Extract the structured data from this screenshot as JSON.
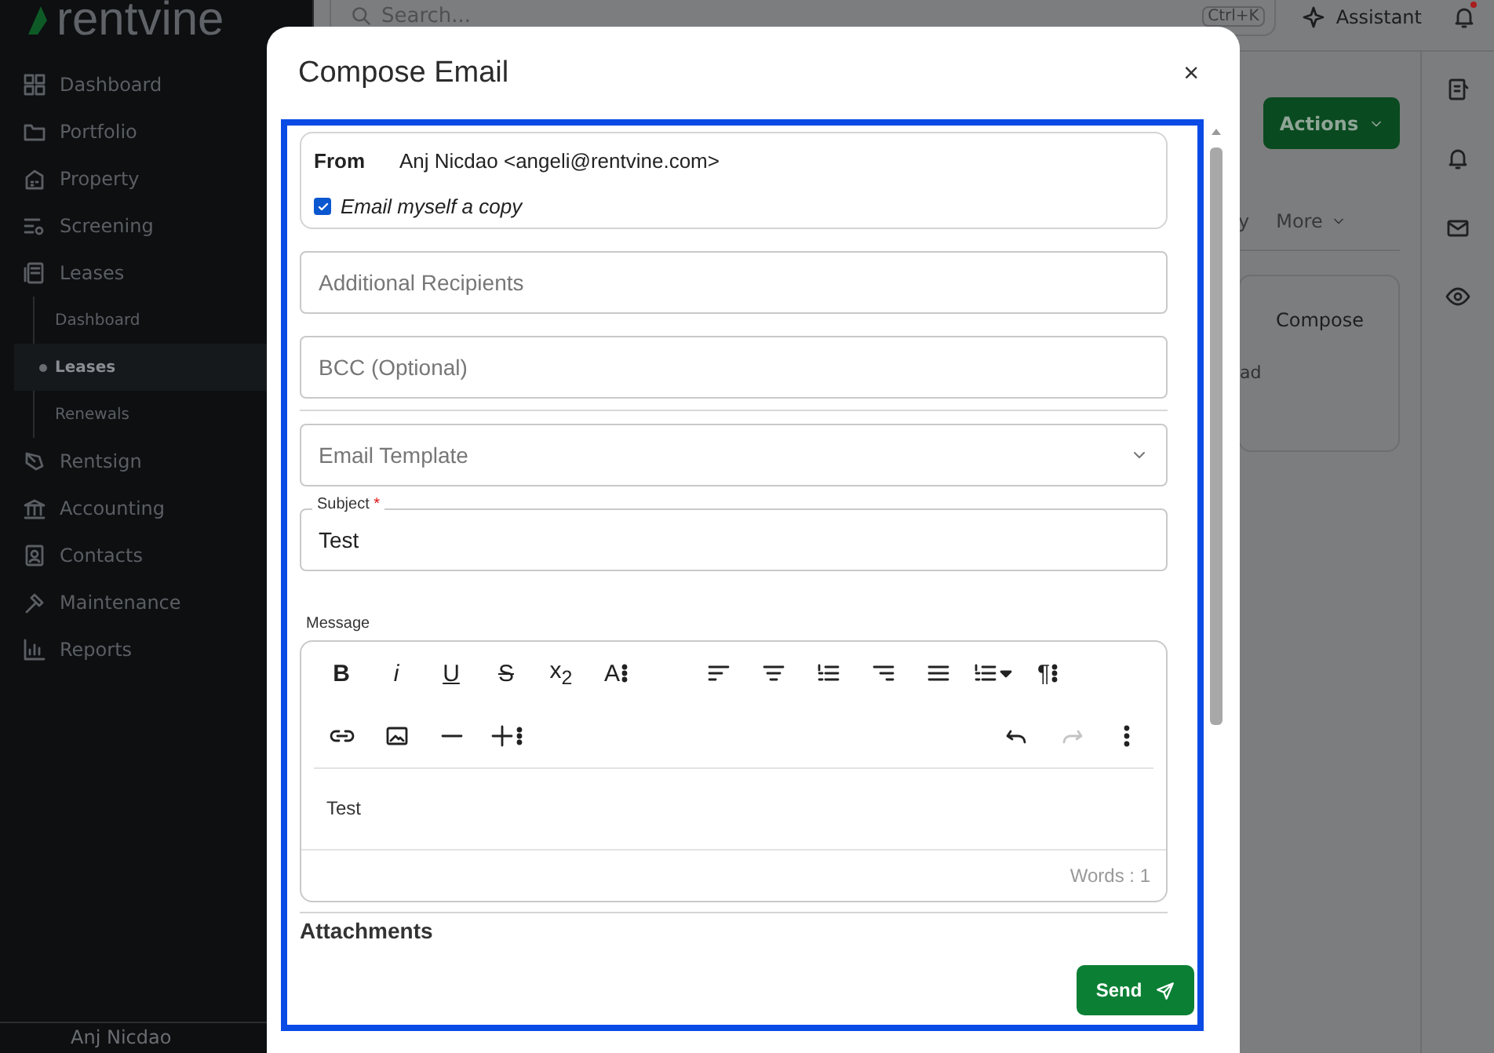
{
  "sidebar": {
    "logo": "rentvine",
    "items": [
      {
        "label": "Dashboard"
      },
      {
        "label": "Portfolio"
      },
      {
        "label": "Property"
      },
      {
        "label": "Screening"
      },
      {
        "label": "Leases",
        "children": [
          {
            "label": "Dashboard",
            "selected": false
          },
          {
            "label": "Leases",
            "selected": true
          },
          {
            "label": "Renewals",
            "selected": false
          }
        ]
      },
      {
        "label": "Rentsign"
      },
      {
        "label": "Accounting"
      },
      {
        "label": "Contacts"
      },
      {
        "label": "Maintenance"
      },
      {
        "label": "Reports"
      }
    ],
    "user": "Anj Nicdao"
  },
  "topbar": {
    "search_placeholder": "Search...",
    "shortcut": "Ctrl+K",
    "assistant": "Assistant",
    "notification_unread": true
  },
  "page": {
    "actions_button": "Actions",
    "tab_fragment": "y",
    "more_tab": "More",
    "card_title": "Compose",
    "card_fragment": "ad"
  },
  "dialog": {
    "title": "Compose Email",
    "close": "×",
    "from_label": "From",
    "from_value": "Anj Nicdao <angeli@rentvine.com>",
    "copy_label": "Email myself a copy",
    "copy_checked": true,
    "recipients": {
      "placeholder": "Additional Recipients"
    },
    "bcc": {
      "placeholder": "BCC (Optional)"
    },
    "template": {
      "placeholder": "Email Template"
    },
    "subject": {
      "label": "Subject",
      "required_mark": "*",
      "value": "Test"
    },
    "message_label": "Message",
    "toolbar_rows": [
      {
        "groups": [
          [
            {
              "kind": "bold",
              "label": "B",
              "disabled": false
            },
            {
              "kind": "italic",
              "label": "i",
              "disabled": false
            },
            {
              "kind": "underline",
              "label": "U",
              "disabled": false
            },
            {
              "kind": "strike",
              "label": "S",
              "disabled": false
            },
            {
              "kind": "subscript",
              "label": "x",
              "sub": "2",
              "disabled": false
            },
            {
              "kind": "fontsize",
              "label": "A",
              "disabled": false
            }
          ],
          [
            {
              "kind": "align-left",
              "disabled": false
            },
            {
              "kind": "align-center",
              "disabled": false
            },
            {
              "kind": "ordered-list",
              "disabled": false
            },
            {
              "kind": "align-right",
              "disabled": false
            },
            {
              "kind": "justify",
              "disabled": false
            },
            {
              "kind": "list-dropdown",
              "disabled": false
            },
            {
              "kind": "paragraph",
              "label": "¶",
              "disabled": false
            }
          ]
        ]
      },
      {
        "groups": [
          [
            {
              "kind": "link",
              "disabled": false
            },
            {
              "kind": "image",
              "disabled": false
            },
            {
              "kind": "rule",
              "disabled": false
            },
            {
              "kind": "insert",
              "disabled": false
            }
          ],
          [
            {
              "kind": "undo",
              "disabled": false
            },
            {
              "kind": "redo",
              "disabled": true
            },
            {
              "kind": "more",
              "disabled": false
            }
          ]
        ]
      }
    ],
    "body": "Test",
    "word_count": "Words : 1",
    "attachments_label": "Attachments",
    "send": "Send"
  }
}
